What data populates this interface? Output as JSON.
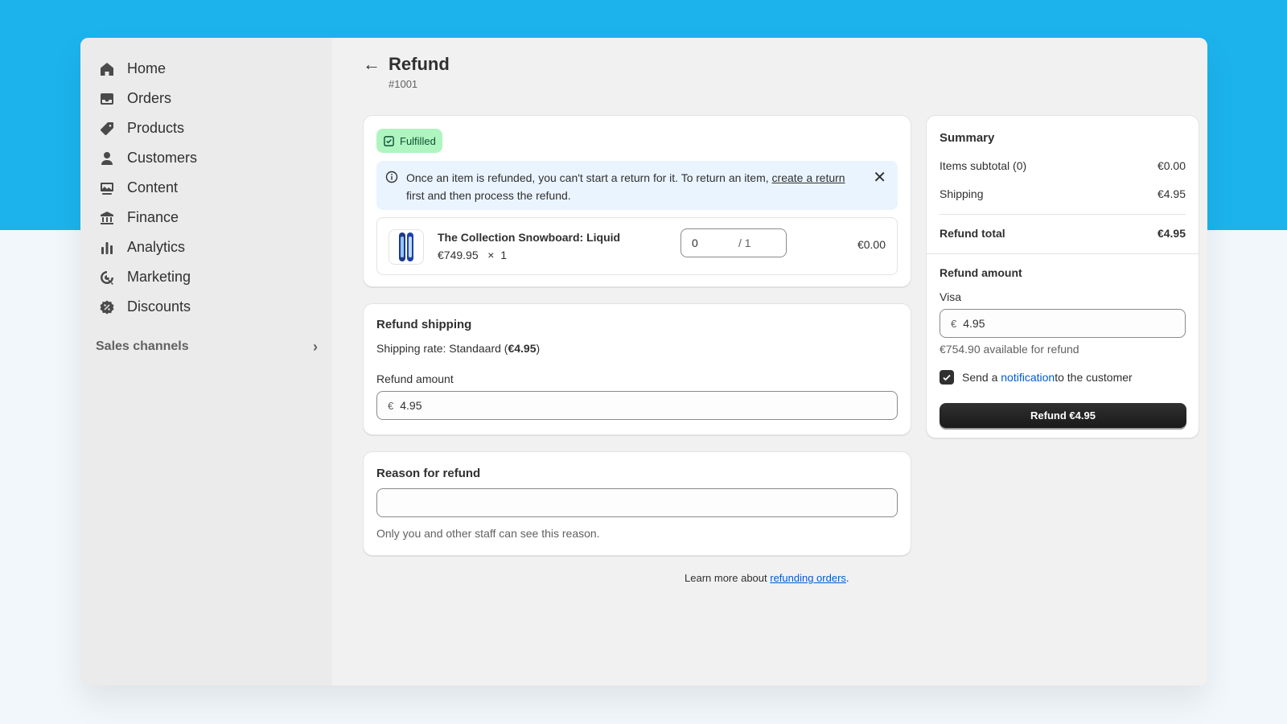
{
  "sidebar": {
    "items": [
      {
        "label": "Home"
      },
      {
        "label": "Orders"
      },
      {
        "label": "Products"
      },
      {
        "label": "Customers"
      },
      {
        "label": "Content"
      },
      {
        "label": "Finance"
      },
      {
        "label": "Analytics"
      },
      {
        "label": "Marketing"
      },
      {
        "label": "Discounts"
      }
    ],
    "sales_channels": "Sales channels"
  },
  "header": {
    "title": "Refund",
    "order_number": "#1001"
  },
  "fulfilled_card": {
    "badge": "Fulfilled",
    "banner": {
      "text_before": "Once an item is refunded, you can't start a return for it. To return an item, ",
      "link": "create a return",
      "text_after": " first and then process the refund."
    },
    "item": {
      "name": "The Collection Snowboard: Liquid",
      "price": "€749.95",
      "times": "×",
      "quantity": "1",
      "refund_qty": "0",
      "refund_qty_max": "/ 1",
      "line_total": "€0.00"
    }
  },
  "refund_shipping": {
    "title": "Refund shipping",
    "rate_label": "Shipping rate: Standaard (",
    "rate_value": "€4.95",
    "rate_close": ")",
    "amount_label": "Refund amount",
    "currency": "€",
    "amount": "4.95"
  },
  "reason": {
    "title": "Reason for refund",
    "value": "",
    "help": "Only you and other staff can see this reason."
  },
  "footer": {
    "text": "Learn more about ",
    "link": "refunding orders",
    "end": "."
  },
  "summary": {
    "title": "Summary",
    "items_subtotal_label": "Items subtotal (0)",
    "items_subtotal_value": "€0.00",
    "shipping_label": "Shipping",
    "shipping_value": "€4.95",
    "refund_total_label": "Refund total",
    "refund_total_value": "€4.95",
    "refund_amount_title": "Refund amount",
    "method": "Visa",
    "currency": "€",
    "amount": "4.95",
    "available": "€754.90 available for refund",
    "notify_before": "Send a ",
    "notify_link": "notification",
    "notify_after": " to the customer",
    "notify_checked": true,
    "button": "Refund €4.95"
  }
}
